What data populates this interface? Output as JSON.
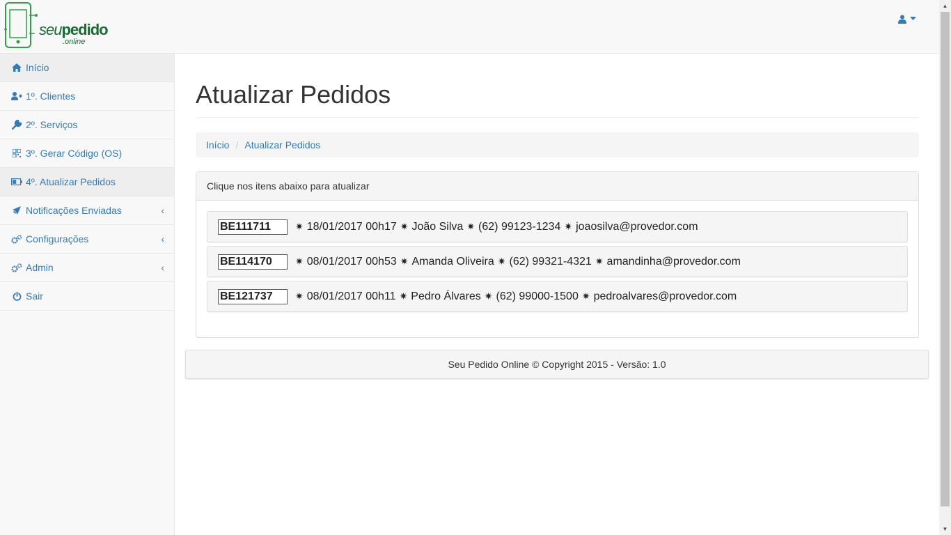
{
  "brand": {
    "logo_text_seu": "seu",
    "logo_text_pedido": "pedido",
    "logo_sub": ".online"
  },
  "sidebar": {
    "items": [
      {
        "label": "Início",
        "icon": "home-icon"
      },
      {
        "label": "1º. Clientes",
        "icon": "user-plus-icon"
      },
      {
        "label": "2º. Serviços",
        "icon": "wrench-icon"
      },
      {
        "label": "3º. Gerar Código (OS)",
        "icon": "qrcode-icon"
      },
      {
        "label": "4º. Atualizar Pedidos",
        "icon": "battery-icon"
      },
      {
        "label": "Notificações Enviadas",
        "icon": "plane-icon"
      },
      {
        "label": "Configurações",
        "icon": "gears-icon"
      },
      {
        "label": "Admin",
        "icon": "gears-icon"
      },
      {
        "label": "Sair",
        "icon": "power-icon"
      }
    ]
  },
  "main": {
    "title": "Atualizar Pedidos",
    "breadcrumb": {
      "home": "Início",
      "current": "Atualizar Pedidos"
    },
    "panel": {
      "heading": "Clique nos itens abaixo para atualizar",
      "orders": [
        {
          "code": "BE111711",
          "datetime": "18/01/2017 00h17",
          "name": "João Silva",
          "phone": "(62) 99123-1234",
          "email": "joaosilva@provedor.com"
        },
        {
          "code": "BE114170",
          "datetime": "08/01/2017 00h53",
          "name": "Amanda Oliveira",
          "phone": "(62) 99321-4321",
          "email": "amandinha@provedor.com"
        },
        {
          "code": "BE121737",
          "datetime": "08/01/2017 00h11",
          "name": "Pedro Álvares",
          "phone": "(62) 99000-1500",
          "email": "pedroalvares@provedor.com"
        }
      ]
    }
  },
  "footer": {
    "text": "Seu Pedido Online © Copyright 2015 - Versão: 1.0"
  },
  "colors": {
    "link": "#337ab7",
    "brand": "#1a6b35"
  }
}
